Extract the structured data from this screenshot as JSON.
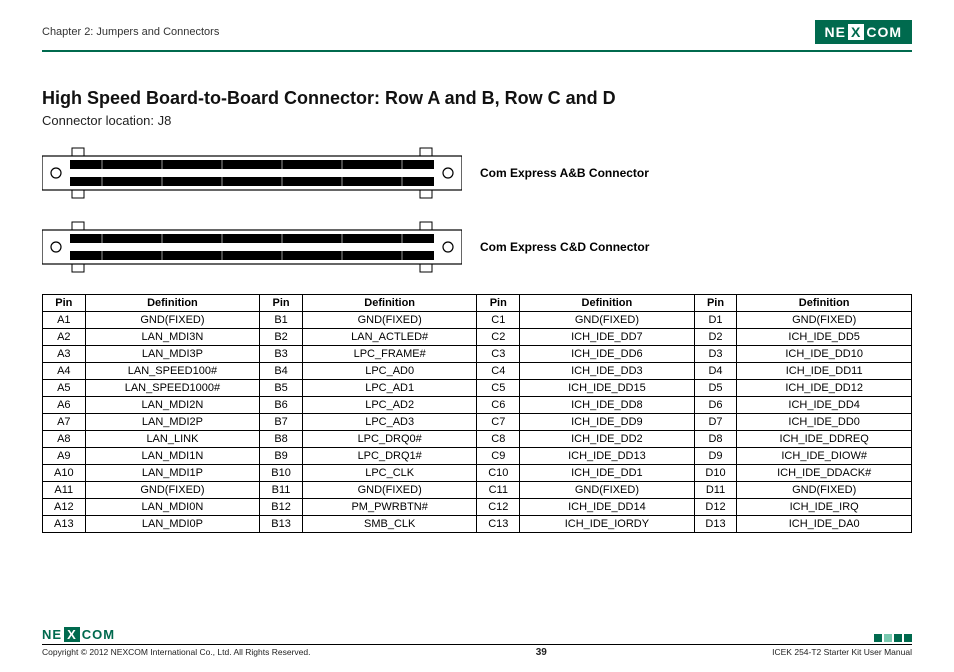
{
  "header": {
    "chapter": "Chapter 2: Jumpers and Connectors",
    "logo_left": "NE",
    "logo_x": "X",
    "logo_right": "COM"
  },
  "heading": "High Speed Board-to-Board Connector: Row A and B, Row C and D",
  "location": "Connector location: J8",
  "connector_ab_label": "Com Express A&B Connector",
  "connector_cd_label": "Com Express C&D Connector",
  "table": {
    "headers": [
      "Pin",
      "Definition",
      "Pin",
      "Definition",
      "Pin",
      "Definition",
      "Pin",
      "Definition"
    ],
    "rows": [
      [
        "A1",
        "GND(FIXED)",
        "B1",
        "GND(FIXED)",
        "C1",
        "GND(FIXED)",
        "D1",
        "GND(FIXED)"
      ],
      [
        "A2",
        "LAN_MDI3N",
        "B2",
        "LAN_ACTLED#",
        "C2",
        "ICH_IDE_DD7",
        "D2",
        "ICH_IDE_DD5"
      ],
      [
        "A3",
        "LAN_MDI3P",
        "B3",
        "LPC_FRAME#",
        "C3",
        "ICH_IDE_DD6",
        "D3",
        "ICH_IDE_DD10"
      ],
      [
        "A4",
        "LAN_SPEED100#",
        "B4",
        "LPC_AD0",
        "C4",
        "ICH_IDE_DD3",
        "D4",
        "ICH_IDE_DD11"
      ],
      [
        "A5",
        "LAN_SPEED1000#",
        "B5",
        "LPC_AD1",
        "C5",
        "ICH_IDE_DD15",
        "D5",
        "ICH_IDE_DD12"
      ],
      [
        "A6",
        "LAN_MDI2N",
        "B6",
        "LPC_AD2",
        "C6",
        "ICH_IDE_DD8",
        "D6",
        "ICH_IDE_DD4"
      ],
      [
        "A7",
        "LAN_MDI2P",
        "B7",
        "LPC_AD3",
        "C7",
        "ICH_IDE_DD9",
        "D7",
        "ICH_IDE_DD0"
      ],
      [
        "A8",
        "LAN_LINK",
        "B8",
        "LPC_DRQ0#",
        "C8",
        "ICH_IDE_DD2",
        "D8",
        "ICH_IDE_DDREQ"
      ],
      [
        "A9",
        "LAN_MDI1N",
        "B9",
        "LPC_DRQ1#",
        "C9",
        "ICH_IDE_DD13",
        "D9",
        "ICH_IDE_DIOW#"
      ],
      [
        "A10",
        "LAN_MDI1P",
        "B10",
        "LPC_CLK",
        "C10",
        "ICH_IDE_DD1",
        "D10",
        "ICH_IDE_DDACK#"
      ],
      [
        "A11",
        "GND(FIXED)",
        "B11",
        "GND(FIXED)",
        "C11",
        "GND(FIXED)",
        "D11",
        "GND(FIXED)"
      ],
      [
        "A12",
        "LAN_MDI0N",
        "B12",
        "PM_PWRBTN#",
        "C12",
        "ICH_IDE_DD14",
        "D12",
        "ICH_IDE_IRQ"
      ],
      [
        "A13",
        "LAN_MDI0P",
        "B13",
        "SMB_CLK",
        "C13",
        "ICH_IDE_IORDY",
        "D13",
        "ICH_IDE_DA0"
      ]
    ]
  },
  "footer": {
    "logo_left": "NE",
    "logo_x": "X",
    "logo_right": "COM",
    "copyright": "Copyright © 2012 NEXCOM International Co., Ltd. All Rights Reserved.",
    "page": "39",
    "doc": "ICEK 254-T2 Starter Kit User Manual"
  }
}
